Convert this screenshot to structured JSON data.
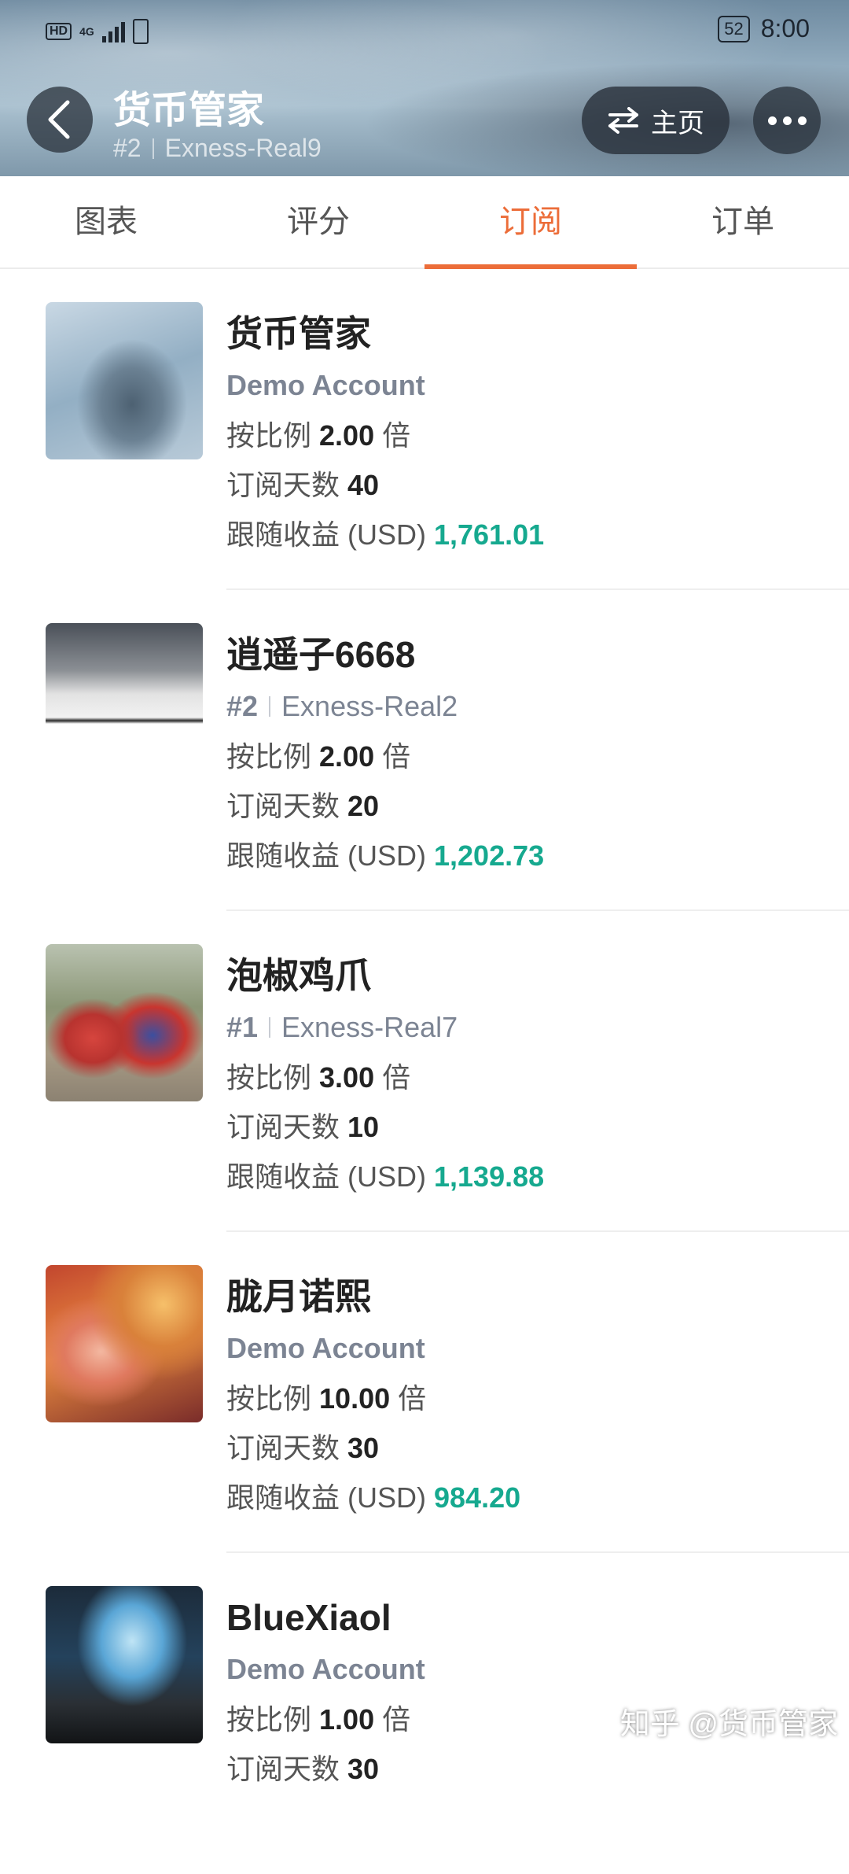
{
  "status_bar": {
    "network": "HD",
    "gen": "4G",
    "battery": "52",
    "time": "8:00"
  },
  "header": {
    "title": "货币管家",
    "rank": "#2",
    "server": "Exness-Real9",
    "home_label": "主页",
    "icons": {
      "back": "back-arrow-icon",
      "swap": "swap-arrows-icon",
      "more": "more-dots-icon"
    }
  },
  "tabs": [
    {
      "label": "图表"
    },
    {
      "label": "评分"
    },
    {
      "label": "订阅",
      "active": true
    },
    {
      "label": "订单"
    }
  ],
  "labels": {
    "ratio_prefix": "按比例",
    "ratio_suffix": "倍",
    "days_prefix": "订阅天数",
    "profit_prefix": "跟随收益 (USD)"
  },
  "subscriptions": [
    {
      "name": "货币管家",
      "account": "Demo Account",
      "rank": "",
      "server": "",
      "ratio": "2.00",
      "days": "40",
      "profit": "1,761.01"
    },
    {
      "name": "逍遥子6668",
      "account": "",
      "rank": "#2",
      "server": "Exness-Real2",
      "ratio": "2.00",
      "days": "20",
      "profit": "1,202.73"
    },
    {
      "name": "泡椒鸡爪",
      "account": "",
      "rank": "#1",
      "server": "Exness-Real7",
      "ratio": "3.00",
      "days": "10",
      "profit": "1,139.88"
    },
    {
      "name": "胧月诺熙",
      "account": "Demo Account",
      "rank": "",
      "server": "",
      "ratio": "10.00",
      "days": "30",
      "profit": "984.20"
    },
    {
      "name": "BlueXiaol",
      "account": "Demo Account",
      "rank": "",
      "server": "",
      "ratio": "1.00",
      "days": "30",
      "profit": ""
    }
  ],
  "watermark": "知乎 @货币管家",
  "colors": {
    "accent": "#ec6d39",
    "profit": "#16a98f",
    "muted": "#7c8493"
  }
}
